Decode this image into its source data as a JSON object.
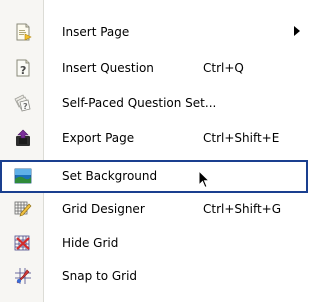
{
  "menu": {
    "items": [
      {
        "label": "Insert Page",
        "shortcut": "",
        "icon": "insert-page-icon",
        "has_submenu": true
      },
      {
        "label": "Insert Question",
        "shortcut": "Ctrl+Q",
        "icon": "insert-question-icon",
        "has_submenu": false
      },
      {
        "label": "Self-Paced Question Set...",
        "shortcut": "",
        "icon": "question-set-icon",
        "has_submenu": false
      },
      {
        "label": "Export Page",
        "shortcut": "Ctrl+Shift+E",
        "icon": "export-page-icon",
        "has_submenu": false
      },
      {
        "label": "Set Background",
        "shortcut": "",
        "icon": "set-background-icon",
        "has_submenu": false,
        "highlighted": true
      },
      {
        "label": "Grid Designer",
        "shortcut": "Ctrl+Shift+G",
        "icon": "grid-designer-icon",
        "has_submenu": false
      },
      {
        "label": "Hide Grid",
        "shortcut": "",
        "icon": "hide-grid-icon",
        "has_submenu": false
      },
      {
        "label": "Snap to Grid",
        "shortcut": "",
        "icon": "snap-to-grid-icon",
        "has_submenu": false
      }
    ]
  },
  "colors": {
    "highlight_border": "#1a3f8f",
    "gutter": "#f7f6f3"
  }
}
